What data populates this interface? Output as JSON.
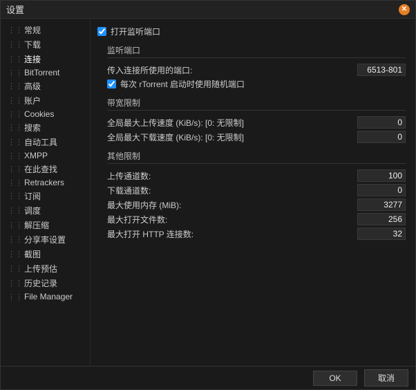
{
  "window": {
    "title": "设置"
  },
  "sidebar": {
    "items": [
      {
        "label": "常规"
      },
      {
        "label": "下载"
      },
      {
        "label": "连接",
        "active": true
      },
      {
        "label": "BitTorrent"
      },
      {
        "label": "高级"
      },
      {
        "label": "账户"
      },
      {
        "label": "Cookies"
      },
      {
        "label": "搜索"
      },
      {
        "label": "自动工具"
      },
      {
        "label": "XMPP"
      },
      {
        "label": "在此查找"
      },
      {
        "label": "Retrackers"
      },
      {
        "label": "订阅"
      },
      {
        "label": "调度"
      },
      {
        "label": "解压缩"
      },
      {
        "label": "分享率设置"
      },
      {
        "label": "截图"
      },
      {
        "label": "上传预估"
      },
      {
        "label": "历史记录"
      },
      {
        "label": "File Manager"
      }
    ]
  },
  "content": {
    "open_listen_port": {
      "label": "打开监听端口",
      "checked": true
    },
    "section_listen": {
      "title": "监听端口",
      "incoming_port_label": "传入连接所使用的端口:",
      "incoming_port_value": "6513-801",
      "random_each_start": {
        "label": "每次 rTorrent 启动时使用随机端口",
        "checked": true
      }
    },
    "section_bandwidth": {
      "title": "带宽限制",
      "max_up_label": "全局最大上传速度 (KiB/s): [0: 无限制]",
      "max_up_value": "0",
      "max_down_label": "全局最大下载速度 (KiB/s): [0: 无限制]",
      "max_down_value": "0"
    },
    "section_other": {
      "title": "其他限制",
      "upload_slots_label": "上传通道数:",
      "upload_slots_value": "100",
      "download_slots_label": "下载通道数:",
      "download_slots_value": "0",
      "max_memory_label": "最大使用内存 (MiB):",
      "max_memory_value": "3277",
      "max_open_files_label": "最大打开文件数:",
      "max_open_files_value": "256",
      "max_http_label": "最大打开 HTTP 连接数:",
      "max_http_value": "32"
    }
  },
  "footer": {
    "ok": "OK",
    "cancel": "取消"
  }
}
